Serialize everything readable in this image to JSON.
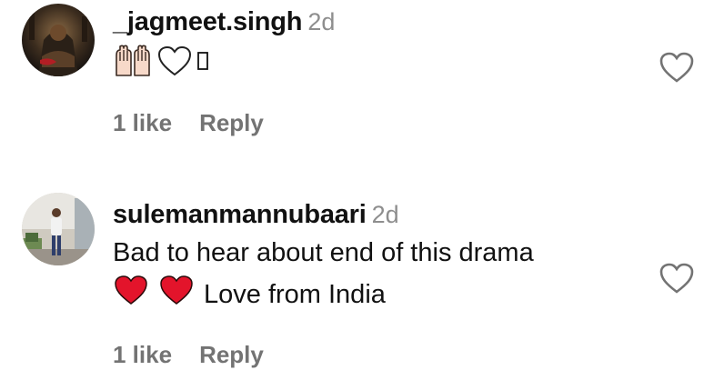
{
  "comments": [
    {
      "username": "_jagmeet.singh",
      "time": "2d",
      "text": "",
      "emoji_suffix": "",
      "likes": "1 like",
      "reply": "Reply"
    },
    {
      "username": "sulemanmannubaari",
      "time": "2d",
      "text": "Bad to hear about end of this drama",
      "emoji_suffix": "Love from India",
      "likes": "1 like",
      "reply": "Reply"
    }
  ],
  "colors": {
    "muted": "#8e8e8e",
    "action": "#737373",
    "heart_red": "#e3142b"
  }
}
